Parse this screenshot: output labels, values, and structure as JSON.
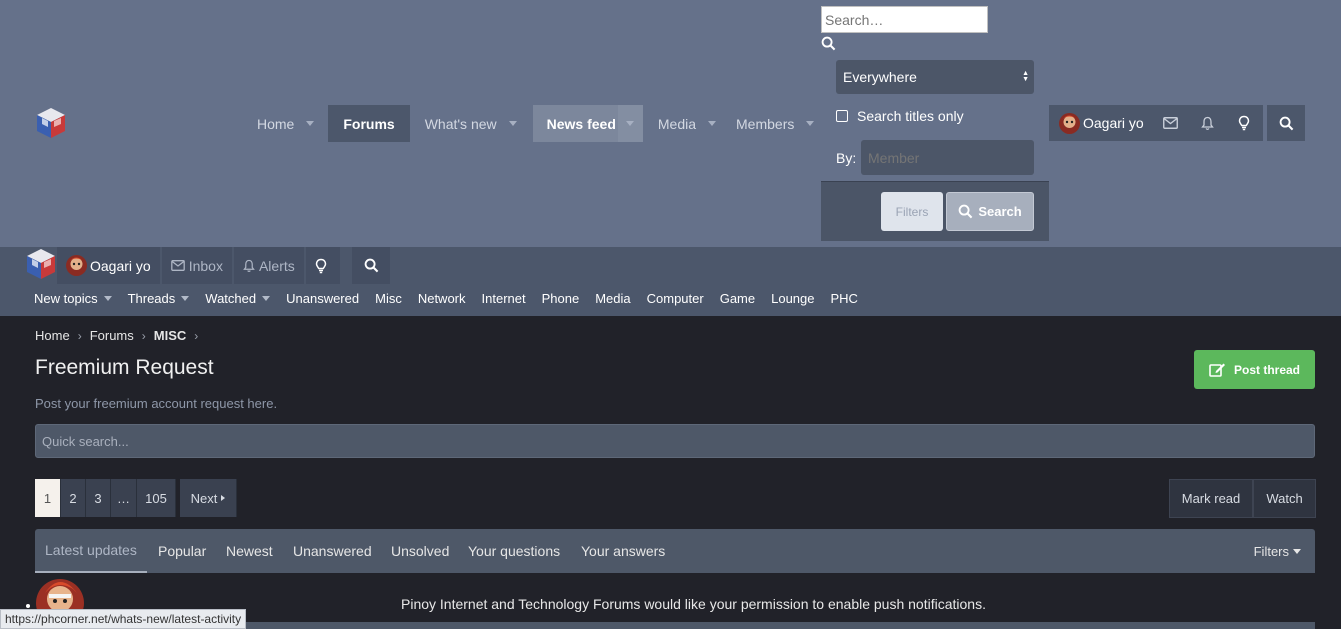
{
  "header": {
    "nav": [
      {
        "label": "Home",
        "has_caret": true
      },
      {
        "label": "Forums",
        "has_caret": false
      },
      {
        "label": "What's new",
        "has_caret": true
      },
      {
        "label": "News feed",
        "has_caret": true
      },
      {
        "label": "Media",
        "has_caret": true
      },
      {
        "label": "Members",
        "has_caret": true
      }
    ],
    "search_menu": {
      "placeholder": "Search…",
      "scope_selected": "Everywhere",
      "titles_only_label": "Search titles only",
      "by_label": "By:",
      "member_placeholder": "Member",
      "filters_label": "Filters",
      "search_label": "Search"
    },
    "account": {
      "username": "Oagari yo"
    }
  },
  "secondary_bar": {
    "username": "Oagari yo",
    "inbox_label": "Inbox",
    "alerts_label": "Alerts",
    "sub_nav": [
      {
        "label": "New topics",
        "has_caret": true
      },
      {
        "label": "Threads",
        "has_caret": true
      },
      {
        "label": "Watched",
        "has_caret": true
      },
      {
        "label": "Unanswered",
        "has_caret": false
      },
      {
        "label": "Misc",
        "has_caret": false
      },
      {
        "label": "Network",
        "has_caret": false
      },
      {
        "label": "Internet",
        "has_caret": false
      },
      {
        "label": "Phone",
        "has_caret": false
      },
      {
        "label": "Media",
        "has_caret": false
      },
      {
        "label": "Computer",
        "has_caret": false
      },
      {
        "label": "Game",
        "has_caret": false
      },
      {
        "label": "Lounge",
        "has_caret": false
      },
      {
        "label": "PHC",
        "has_caret": false
      }
    ]
  },
  "breadcrumb": [
    "Home",
    "Forums",
    "MISC"
  ],
  "page": {
    "title": "Freemium Request",
    "description": "Post your freemium account request here.",
    "post_thread_label": "Post thread",
    "quick_search_placeholder": "Quick search..."
  },
  "pagination": {
    "pages": [
      "1",
      "2",
      "3",
      "…",
      "105"
    ],
    "current": "1",
    "next_label": "Next"
  },
  "actions": {
    "mark_read": "Mark read",
    "watch": "Watch"
  },
  "tabs": {
    "items": [
      "Latest updates",
      "Popular",
      "Newest",
      "Unanswered",
      "Unsolved",
      "Your questions",
      "Your answers"
    ],
    "active": "Latest updates",
    "filters_label": "Filters"
  },
  "notice": {
    "text": "Pinoy Internet and Technology Forums would like your permission to enable push notifications."
  },
  "status_bar": {
    "url": "https://phcorner.net/whats-new/latest-activity"
  },
  "colors": {
    "header_bg": "#65718a",
    "secondary_bg": "#4c576b",
    "body_bg": "#212229",
    "accent_green": "#5cb85c",
    "tab_bar_bg": "#4e5868"
  }
}
